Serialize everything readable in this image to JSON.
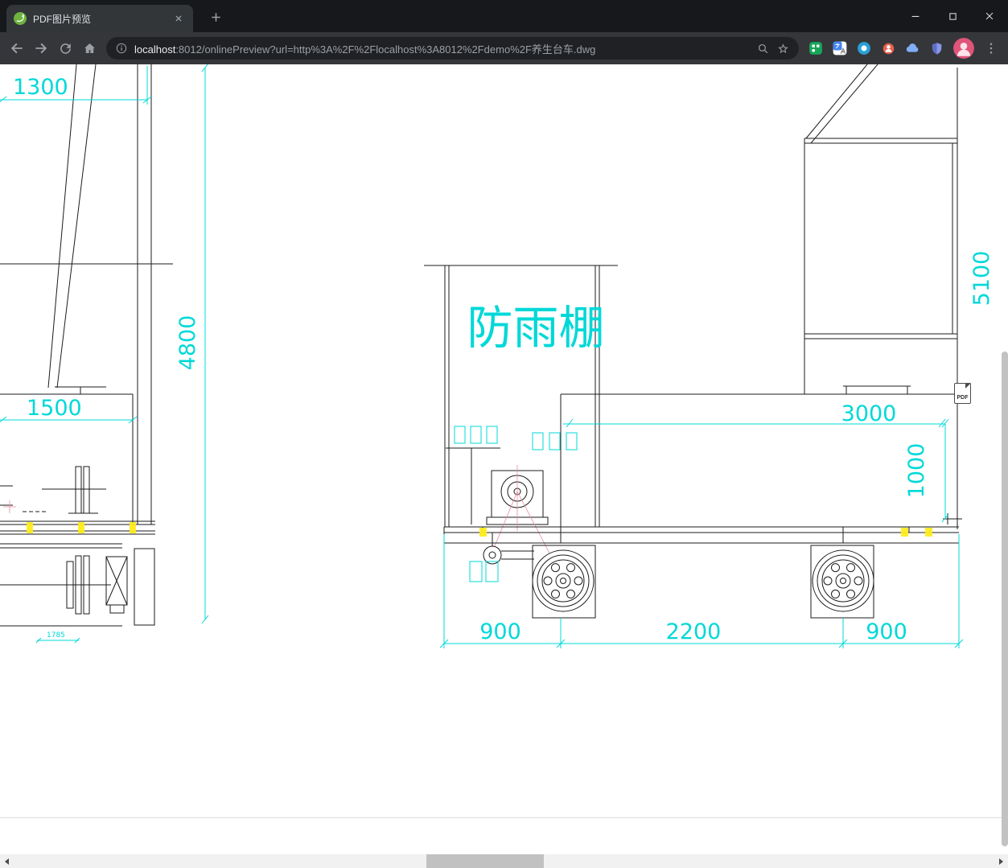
{
  "window": {
    "tab_title": "PDF图片预览"
  },
  "toolbar": {
    "url_host": "localhost",
    "url_rest": ":8012/onlinePreview?url=http%3A%2F%2Flocalhost%3A8012%2Fdemo%2F养生台车.dwg"
  },
  "drawing": {
    "shelter_label": "防雨棚",
    "dim_1300": "1300",
    "dim_4800": "4800",
    "dim_1500": "1500",
    "dim_1785": "1785",
    "dim_5100": "5100",
    "dim_3000": "3000",
    "dim_1000": "1000",
    "dim_900_left": "900",
    "dim_2200": "2200",
    "dim_900_right": "900"
  },
  "pdf_badge": {
    "label": "PDF"
  },
  "colors": {
    "dimension_cyan": "#00d8d8",
    "line_black": "#1b1b1b",
    "highlight_yellow": "#ffec1f",
    "centerline_pink": "#e78ca0",
    "toolbar_dark": "#35363a",
    "tabstrip_dark": "#17181b"
  }
}
